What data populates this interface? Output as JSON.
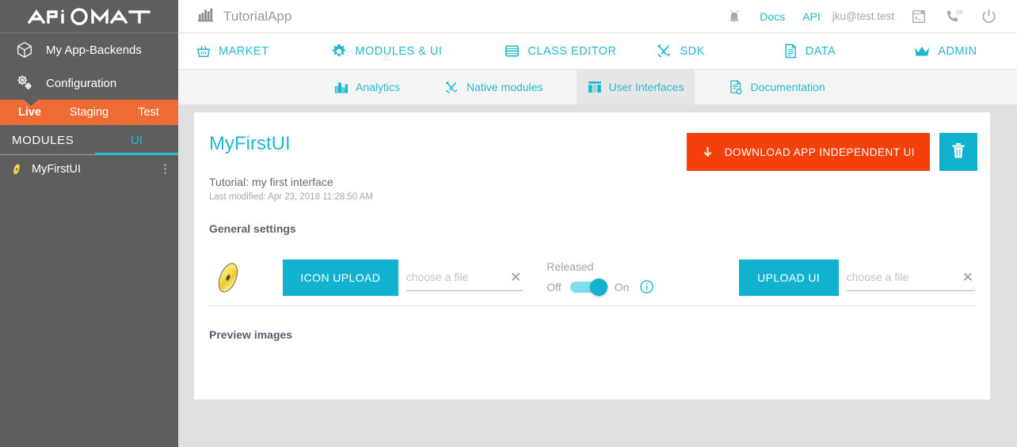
{
  "sidebar": {
    "logo_text": "APIOMAT",
    "links": [
      {
        "label": "My App-Backends",
        "icon": "cube-icon"
      },
      {
        "label": "Configuration",
        "icon": "gears-icon"
      }
    ],
    "env_tabs": [
      {
        "label": "Live",
        "active": true
      },
      {
        "label": "Staging",
        "active": false
      },
      {
        "label": "Test",
        "active": false
      }
    ],
    "module_tabs": [
      {
        "label": "MODULES",
        "active": false
      },
      {
        "label": "UI",
        "active": true
      }
    ],
    "modules": [
      {
        "label": "MyFirstUI",
        "icon": "disc-icon",
        "menu": "kebab-menu-icon"
      }
    ]
  },
  "topbar": {
    "app_title": "TutorialApp",
    "app_icon": "factory-icon",
    "bell_icon": "notification-bell-icon",
    "docs_label": "Docs",
    "api_label": "API",
    "user_email": "jku@test.test",
    "console_icon": "terminal-icon",
    "support_icon": "phone-24-7-icon",
    "power_icon": "power-logout-icon"
  },
  "mainnav": {
    "items": [
      {
        "label": "MARKET",
        "icon": "basket-icon",
        "active": false
      },
      {
        "label": "MODULES & UI",
        "icon": "gear-icon",
        "active": true
      },
      {
        "label": "CLASS EDITOR",
        "icon": "table-icon",
        "active": false
      },
      {
        "label": "SDK",
        "icon": "tools-icon",
        "active": false
      },
      {
        "label": "DATA",
        "icon": "document-icon",
        "active": false
      },
      {
        "label": "ADMIN",
        "icon": "crown-icon",
        "active": false
      }
    ]
  },
  "subnav": {
    "items": [
      {
        "label": "Analytics",
        "icon": "chart-icon",
        "active": false
      },
      {
        "label": "Native modules",
        "icon": "tools-icon",
        "active": false
      },
      {
        "label": "User Interfaces",
        "icon": "grid-layout-icon",
        "active": true
      },
      {
        "label": "Documentation",
        "icon": "doc-help-icon",
        "active": false
      }
    ]
  },
  "card": {
    "title": "MyFirstUI",
    "download_label": "DOWNLOAD APP INDEPENDENT UI",
    "download_icon": "download-arrow-icon",
    "delete_icon": "trash-icon",
    "description": "Tutorial: my first interface",
    "last_modified": "Last modified: Apr 23, 2018 11:28:50 AM",
    "general_settings_title": "General settings",
    "app_icon": "disc-icon",
    "icon_upload_label": "ICON UPLOAD",
    "icon_file_placeholder": "choose a file",
    "icon_file_value": "",
    "icon_clear_icon": "clear-x-icon",
    "released_label": "Released",
    "released_off_label": "Off",
    "released_on_label": "On",
    "released_state": "On",
    "released_info_icon": "info-icon",
    "upload_ui_label": "UPLOAD UI",
    "ui_file_placeholder": "choose a file",
    "ui_file_value": "",
    "ui_clear_icon": "clear-x-icon",
    "preview_images_title": "Preview images"
  },
  "colors": {
    "teal": "#11b2cf",
    "orange_accent": "#ee6b36",
    "download_red": "#f4410c",
    "sidebar_grey": "#5e5e5e",
    "page_bg": "#e0e0e0"
  }
}
